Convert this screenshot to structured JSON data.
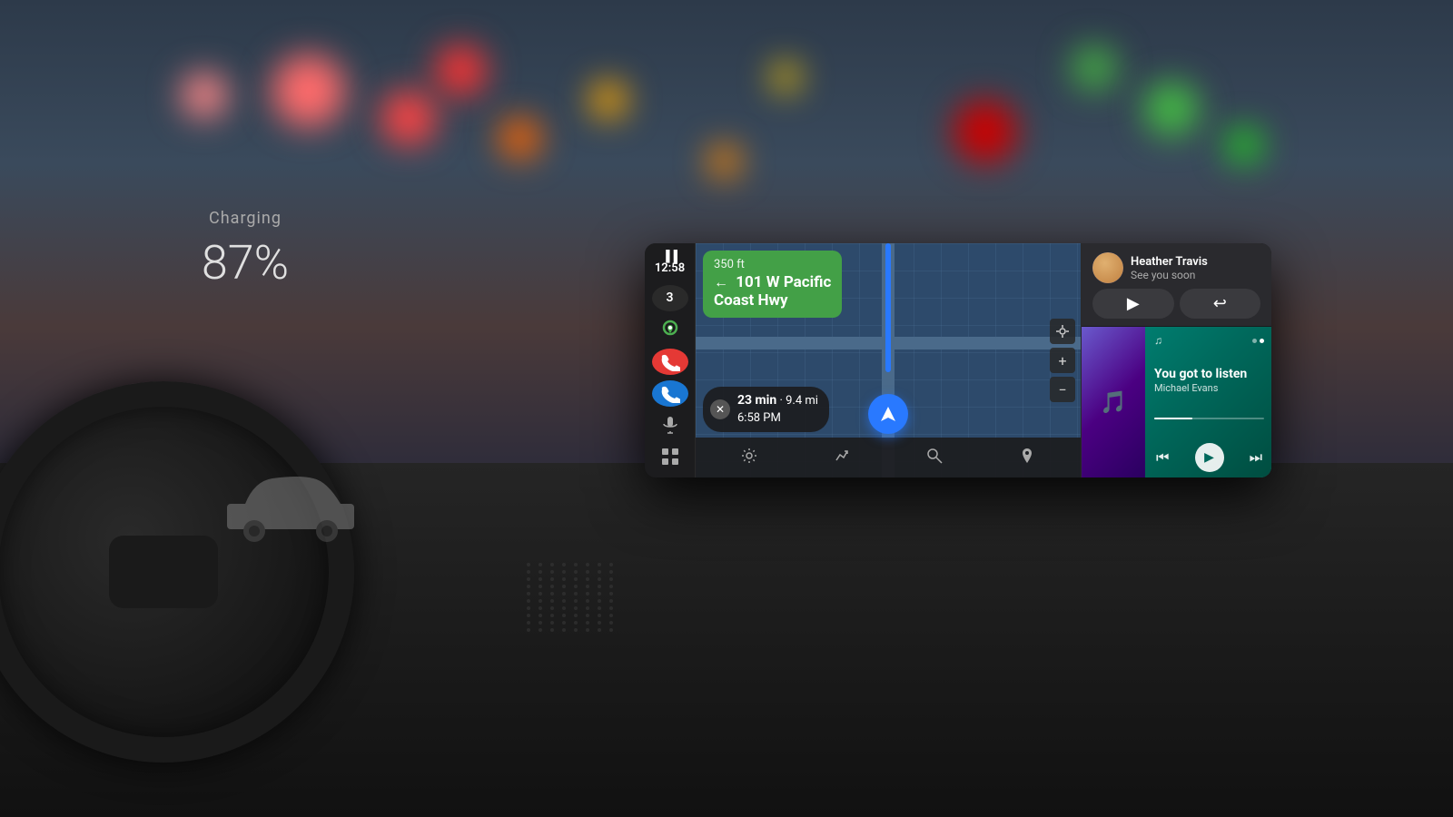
{
  "bg": {
    "colors": {
      "sky": "#2d3a4a",
      "sunset": "#4a3a3a",
      "dark": "#1a1a28"
    }
  },
  "instrument_cluster": {
    "charging_label": "Charging",
    "battery_percent": "87%"
  },
  "android_auto": {
    "status_bar": {
      "signal": "▐▐▐",
      "time": "12:58",
      "notification_count": "3"
    },
    "sidebar": {
      "maps_icon": "🗺",
      "phone_icon": "📞",
      "mic_icon": "🎙",
      "grid_icon": "⊞",
      "notification_badge": "3"
    },
    "navigation": {
      "distance": "350 ft",
      "street": "101 W Pacific Coast Hwy",
      "turn_direction": "←",
      "trip_duration": "23 min",
      "trip_distance": "9.4 mi",
      "eta": "6:58 PM"
    },
    "map_controls": {
      "location_icon": "⊕",
      "zoom_in": "+",
      "zoom_out": "−"
    },
    "toolbar": {
      "settings_icon": "⚙",
      "route_icon": "⇌",
      "search_icon": "🔍",
      "pin_icon": "📍"
    }
  },
  "message_card": {
    "sender_name": "Heather Travis",
    "message_text": "See you soon",
    "reply_icon": "▶",
    "message_icon": "↩"
  },
  "music_card": {
    "song_title": "You got to listen",
    "artist": "Michael Evans",
    "app_icon": "♫",
    "prev_icon": "⏮",
    "play_icon": "▶",
    "next_icon": "⏭",
    "progress_percent": 35
  }
}
